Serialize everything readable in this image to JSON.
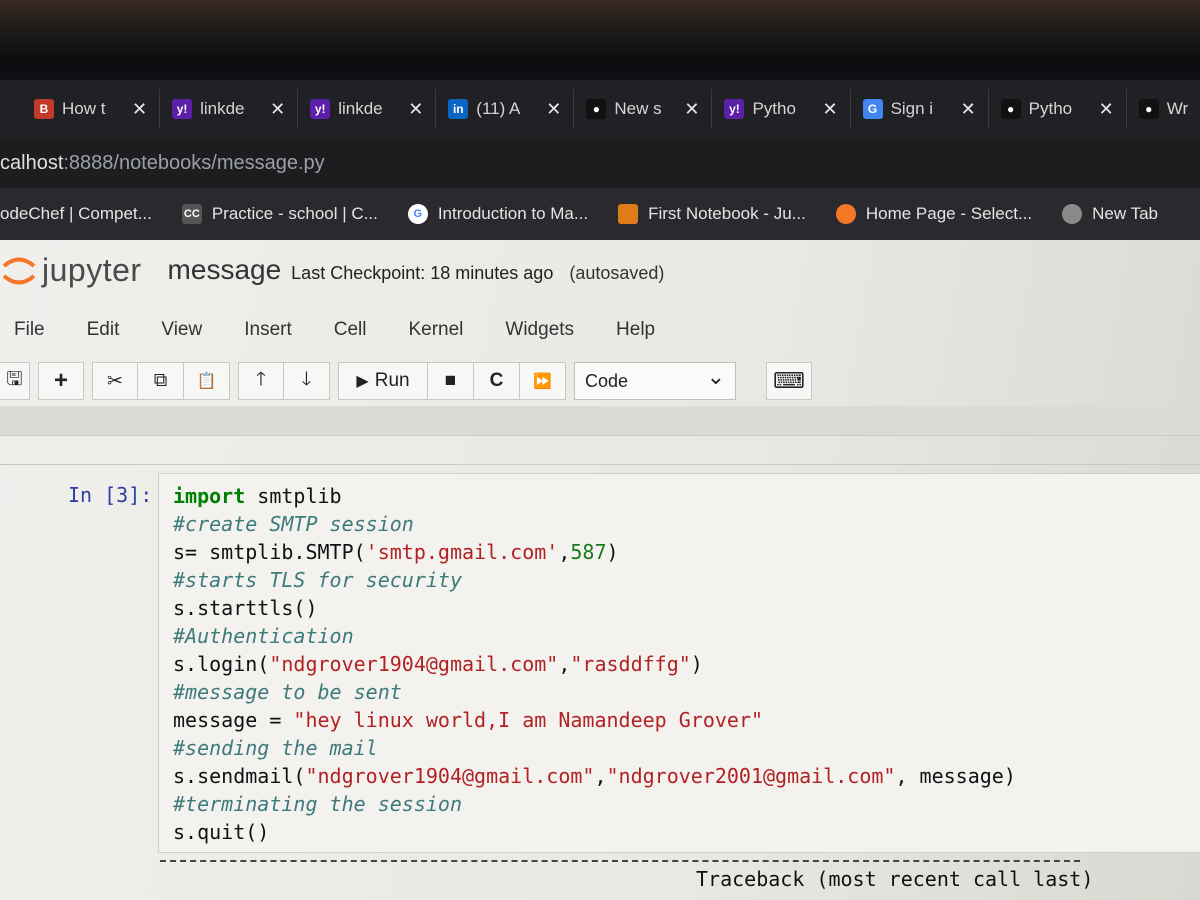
{
  "browser": {
    "tabs": [
      {
        "icon": "blogger-icon",
        "title": "How t",
        "color": "#c0392b"
      },
      {
        "icon": "yahoo-icon",
        "title": "linkde",
        "color": "#5b1fa8"
      },
      {
        "icon": "yahoo-icon",
        "title": "linkde",
        "color": "#5b1fa8"
      },
      {
        "icon": "linkedin-icon",
        "title": "(11) A",
        "color": "#0a66c2"
      },
      {
        "icon": "medium-icon",
        "title": "New s",
        "color": "#111111"
      },
      {
        "icon": "yahoo-icon",
        "title": "Pytho",
        "color": "#5b1fa8"
      },
      {
        "icon": "google-icon",
        "title": "Sign i",
        "color": "#4285f4"
      },
      {
        "icon": "medium-icon",
        "title": "Pytho",
        "color": "#111111"
      },
      {
        "icon": "medium-icon",
        "title": "Wr",
        "color": "#111111"
      }
    ],
    "tab_close_glyph": "✕",
    "favicon_glyphs": {
      "yahoo": "y!",
      "linkedin": "in",
      "medium": "●",
      "google": "G",
      "blogger": "B"
    },
    "address": {
      "host": "calhost",
      "path": ":8888/notebooks/message.py"
    },
    "bookmarks": [
      {
        "label": "odeChef | Compet...",
        "icon": "codechef-icon",
        "color": "#5b4636",
        "glyph": ""
      },
      {
        "label": "Practice - school | C...",
        "icon": "codingcompetitions-icon",
        "color": "#555555",
        "glyph": "CC"
      },
      {
        "label": "Introduction to Ma...",
        "icon": "google-icon",
        "color": "#ffffff",
        "glyph": "G"
      },
      {
        "label": "First Notebook - Ju...",
        "icon": "notebook-icon",
        "color": "#e07b1a",
        "glyph": ""
      },
      {
        "label": "Home Page - Select...",
        "icon": "jupyter-icon",
        "color": "#f37726",
        "glyph": ""
      },
      {
        "label": "New Tab",
        "icon": "globe-icon",
        "color": "#8a8a8a",
        "glyph": ""
      }
    ]
  },
  "jupyter": {
    "logo": "jupyter",
    "notebook_name": "message",
    "checkpoint": "Last Checkpoint: 18 minutes ago",
    "autosaved": "(autosaved)",
    "menu": [
      "File",
      "Edit",
      "View",
      "Insert",
      "Cell",
      "Kernel",
      "Widgets",
      "Help"
    ],
    "toolbar": {
      "run_label": "Run",
      "cell_type": "Code",
      "glyphs": {
        "save": "🖫",
        "add": "+",
        "cut": "✂",
        "copy": "⧉",
        "paste": "📋",
        "up": "🡑",
        "down": "🡓",
        "run": "▶",
        "stop": "■",
        "restart": "C",
        "fast_forward": "⏩",
        "chevron": "⌄",
        "keyboard": "⌨"
      }
    },
    "cell": {
      "prompt": "In [3]:",
      "lines": [
        [
          {
            "t": "kw",
            "v": "import"
          },
          {
            "t": "n",
            "v": " smtplib"
          }
        ],
        [
          {
            "t": "cm",
            "v": "#create SMTP session"
          }
        ],
        [
          {
            "t": "n",
            "v": "s= smtplib.SMTP("
          },
          {
            "t": "str",
            "v": "'smtp.gmail.com'"
          },
          {
            "t": "n",
            "v": ","
          },
          {
            "t": "num",
            "v": "587"
          },
          {
            "t": "n",
            "v": ")"
          }
        ],
        [
          {
            "t": "cm",
            "v": "#starts TLS for security"
          }
        ],
        [
          {
            "t": "n",
            "v": "s.starttls()"
          }
        ],
        [
          {
            "t": "cm",
            "v": "#Authentication"
          }
        ],
        [
          {
            "t": "n",
            "v": "s.login("
          },
          {
            "t": "str",
            "v": "\"ndgrover1904@gmail.com\""
          },
          {
            "t": "n",
            "v": ","
          },
          {
            "t": "str",
            "v": "\"rasddffg\""
          },
          {
            "t": "n",
            "v": ")"
          }
        ],
        [
          {
            "t": "cm",
            "v": "#message to be sent"
          }
        ],
        [
          {
            "t": "n",
            "v": "message = "
          },
          {
            "t": "str",
            "v": "\"hey linux world,I am Namandeep Grover\""
          }
        ],
        [
          {
            "t": "cm",
            "v": "#sending the mail"
          }
        ],
        [
          {
            "t": "n",
            "v": "s.sendmail("
          },
          {
            "t": "str",
            "v": "\"ndgrover1904@gmail.com\""
          },
          {
            "t": "n",
            "v": ","
          },
          {
            "t": "str",
            "v": "\"ndgrover2001@gmail.com\""
          },
          {
            "t": "n",
            "v": ", message)"
          }
        ],
        [
          {
            "t": "cm",
            "v": "#terminating the session"
          }
        ],
        [
          {
            "t": "n",
            "v": "s.quit()"
          }
        ]
      ]
    },
    "traceback": "Traceback (most recent call last)"
  }
}
